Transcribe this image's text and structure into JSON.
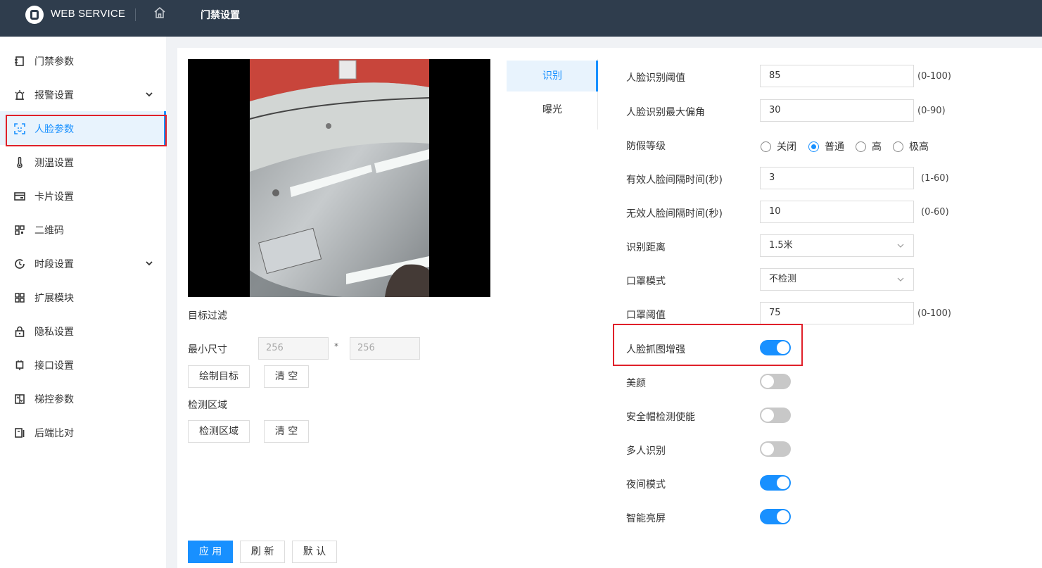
{
  "header": {
    "brand": "WEB SERVICE",
    "title": "门禁设置"
  },
  "sidebar": {
    "items": [
      {
        "label": "门禁参数",
        "icon": "door-params-icon"
      },
      {
        "label": "报警设置",
        "icon": "alarm-icon",
        "expandable": true
      },
      {
        "label": "人脸参数",
        "icon": "face-scan-icon",
        "active": true
      },
      {
        "label": "测温设置",
        "icon": "thermometer-icon"
      },
      {
        "label": "卡片设置",
        "icon": "card-icon"
      },
      {
        "label": "二维码",
        "icon": "qrcode-icon"
      },
      {
        "label": "时段设置",
        "icon": "clock-icon",
        "expandable": true
      },
      {
        "label": "扩展模块",
        "icon": "grid-icon"
      },
      {
        "label": "隐私设置",
        "icon": "lock-icon"
      },
      {
        "label": "接口设置",
        "icon": "interface-icon"
      },
      {
        "label": "梯控参数",
        "icon": "elevator-icon"
      },
      {
        "label": "后端比对",
        "icon": "compare-icon"
      }
    ]
  },
  "left_panel": {
    "target_filter_label": "目标过滤",
    "min_size_label": "最小尺寸",
    "min_width": "256",
    "size_separator": "*",
    "min_height": "256",
    "draw_target_button": "绘制目标",
    "clear_button_1": "清 空",
    "detect_area_label": "检测区域",
    "detect_area_button": "检测区域",
    "clear_button_2": "清 空"
  },
  "tabs": [
    "识别",
    "曝光"
  ],
  "form": {
    "face_threshold": {
      "label": "人脸识别阈值",
      "value": "85",
      "range": "(0-100)"
    },
    "face_max_angle": {
      "label": "人脸识别最大偏角",
      "value": "30",
      "range": "(0-90)"
    },
    "anti_spoof": {
      "label": "防假等级",
      "options": [
        "关闭",
        "普通",
        "高",
        "极高"
      ],
      "selected": "普通"
    },
    "valid_interval": {
      "label": "有效人脸间隔时间(秒)",
      "value": "3",
      "range": "(1-60)"
    },
    "invalid_interval": {
      "label": "无效人脸间隔时间(秒)",
      "value": "10",
      "range": "(0-60)"
    },
    "distance": {
      "label": "识别距离",
      "value": "1.5米"
    },
    "mask_mode": {
      "label": "口罩模式",
      "value": "不检测"
    },
    "mask_threshold": {
      "label": "口罩阈值",
      "value": "75",
      "range": "(0-100)"
    },
    "toggles": [
      {
        "label": "人脸抓图增强",
        "on": true
      },
      {
        "label": "美颜",
        "on": false
      },
      {
        "label": "安全帽检测使能",
        "on": false
      },
      {
        "label": "多人识别",
        "on": false
      },
      {
        "label": "夜间模式",
        "on": true
      },
      {
        "label": "智能亮屏",
        "on": true
      }
    ]
  },
  "footer": {
    "apply": "应 用",
    "refresh": "刷 新",
    "default": "默 认"
  },
  "colors": {
    "header_bg": "#2f3d4d",
    "accent": "#1890ff",
    "highlight_border": "#e0202a"
  }
}
